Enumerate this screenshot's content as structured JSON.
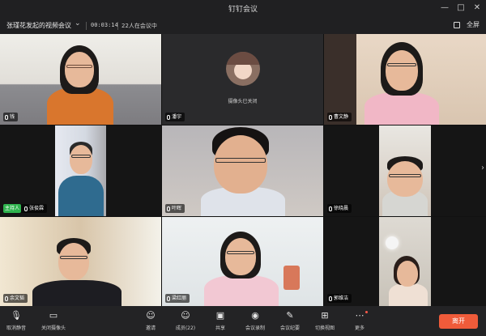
{
  "app": {
    "title": "钉钉会议"
  },
  "window": {
    "minimize": "—",
    "maximize": "□",
    "close": "✕"
  },
  "meeting": {
    "title": "张瑾花发起的视频会议",
    "timer": "00:03:14",
    "participants_text": "22人在会议中",
    "fullscreen_label": "全屏"
  },
  "tiles": [
    {
      "name": "钱",
      "mic": "on"
    },
    {
      "name": "潘宇",
      "mic": "on",
      "avatar_caption": "摄像头已关闭"
    },
    {
      "name": "曹文静",
      "mic": "on"
    },
    {
      "name": "张俊霖",
      "mic": "on",
      "host_label": "主持人"
    },
    {
      "name": "叶晖",
      "mic": "on"
    },
    {
      "name": "徐晓晨",
      "mic": "on"
    },
    {
      "name": "余文韬",
      "mic": "on"
    },
    {
      "name": "梁红丽",
      "mic": "on"
    },
    {
      "name": "郭维洁",
      "mic": "on"
    }
  ],
  "toolbar": {
    "unmute": "取消静音",
    "camera": "关闭摄像头",
    "invite": "邀请",
    "members": "成员(22)",
    "share": "共享",
    "record": "会议录制",
    "minutes": "会议纪要",
    "layout": "切换视图",
    "more": "更多",
    "leave": "离开"
  },
  "colors": {
    "leave": "#ef5b3a",
    "host": "#2fb34e",
    "background": "#1c1c1e"
  }
}
